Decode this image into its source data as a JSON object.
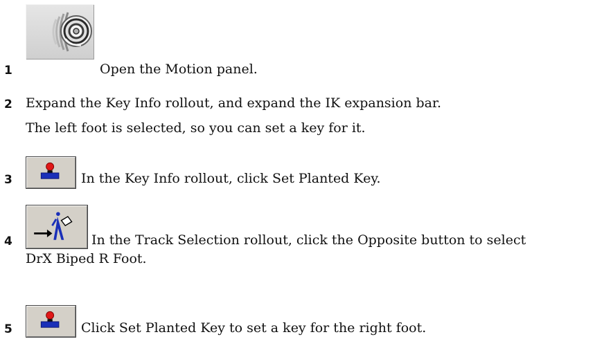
{
  "steps": [
    {
      "number": "1",
      "text": "Open the Motion panel.",
      "icon": "motion-panel-icon"
    },
    {
      "number": "2",
      "text": "Expand the Key Info rollout, and expand the IK expansion bar.",
      "note": "The left foot is selected, so you can set a key for it."
    },
    {
      "number": "3",
      "text": "In the Key Info rollout, click Set Planted Key.",
      "icon": "set-planted-key-icon"
    },
    {
      "number": "4",
      "text": "In the Track Selection rollout, click the Opposite button to select",
      "text_cont": "DrX Biped R Foot.",
      "icon": "opposite-track-icon"
    },
    {
      "number": "5",
      "text": "Click Set Planted Key to set a key for the right foot.",
      "icon": "set-planted-key-icon"
    }
  ]
}
